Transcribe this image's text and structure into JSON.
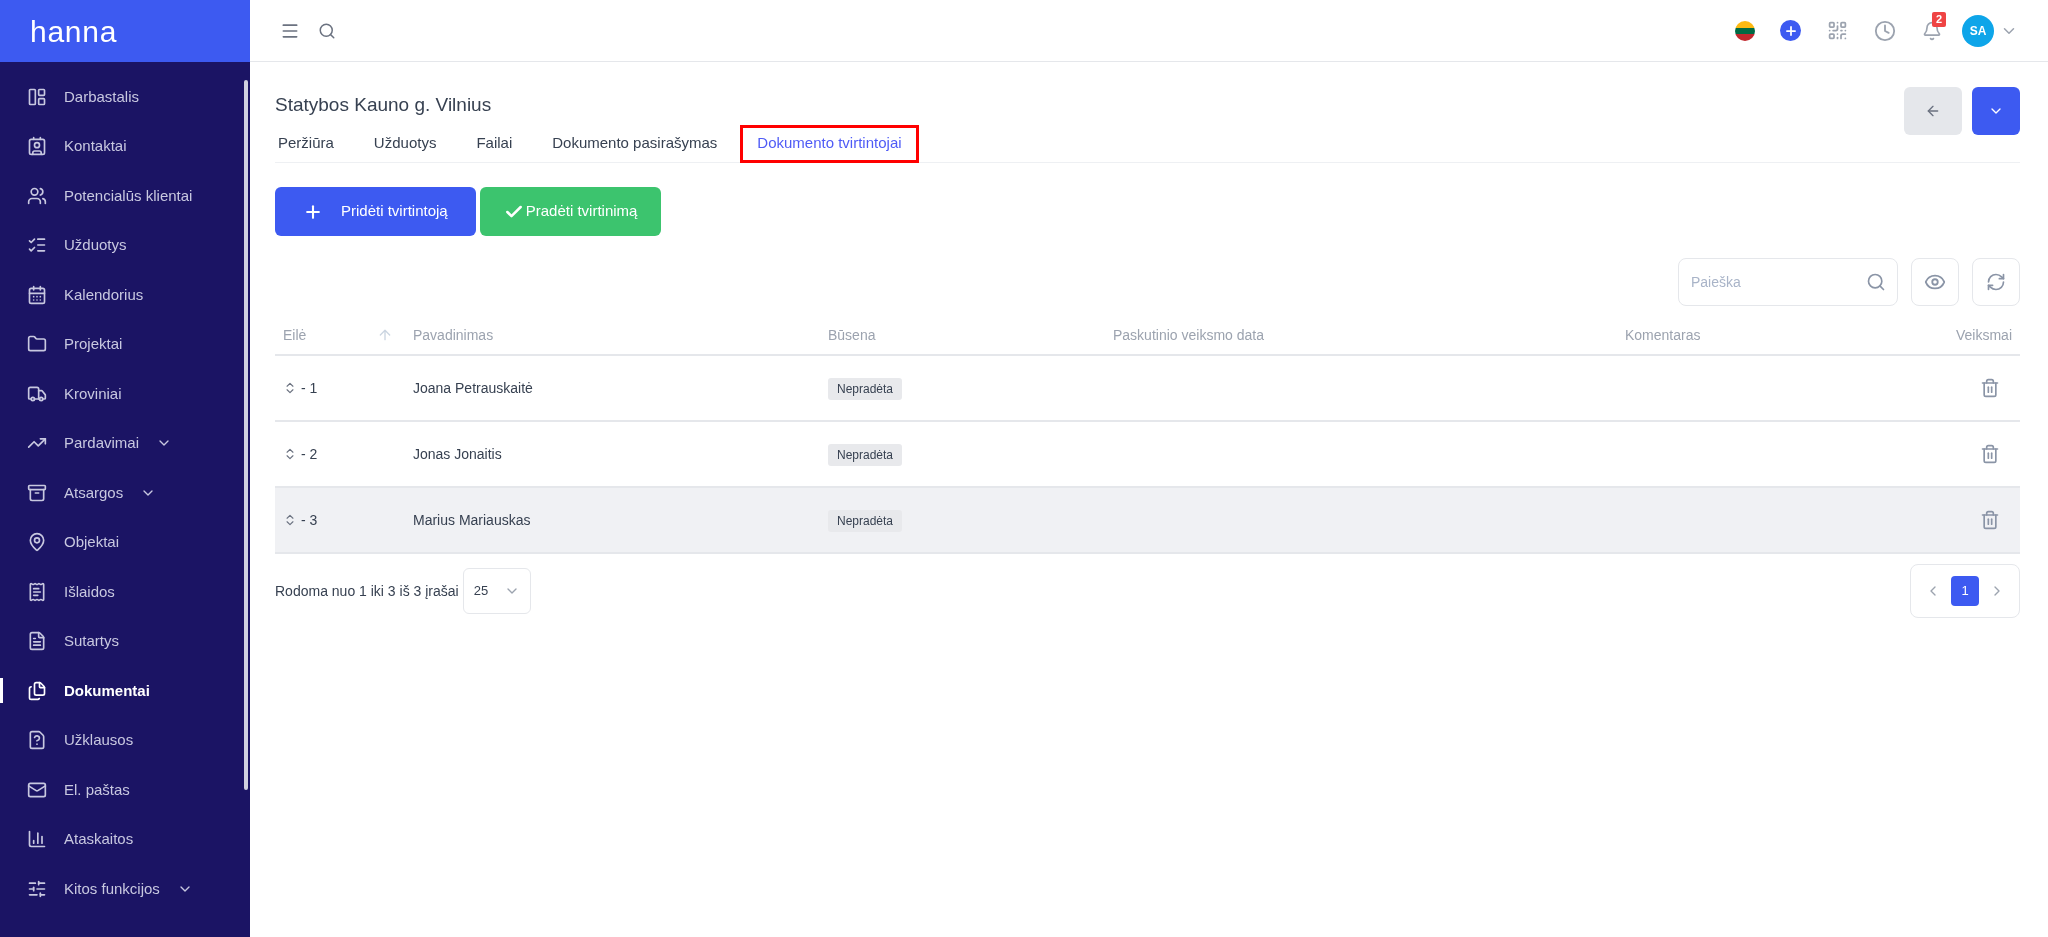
{
  "brand": "hanna",
  "sidebar": {
    "items": [
      {
        "label": "Darbastalis",
        "selected": false,
        "expandable": false
      },
      {
        "label": "Kontaktai",
        "selected": false,
        "expandable": false
      },
      {
        "label": "Potencialūs klientai",
        "selected": false,
        "expandable": false
      },
      {
        "label": "Užduotys",
        "selected": false,
        "expandable": false
      },
      {
        "label": "Kalendorius",
        "selected": false,
        "expandable": false
      },
      {
        "label": "Projektai",
        "selected": false,
        "expandable": false
      },
      {
        "label": "Kroviniai",
        "selected": false,
        "expandable": false
      },
      {
        "label": "Pardavimai",
        "selected": false,
        "expandable": true
      },
      {
        "label": "Atsargos",
        "selected": false,
        "expandable": true
      },
      {
        "label": "Objektai",
        "selected": false,
        "expandable": false
      },
      {
        "label": "Išlaidos",
        "selected": false,
        "expandable": false
      },
      {
        "label": "Sutartys",
        "selected": false,
        "expandable": false
      },
      {
        "label": "Dokumentai",
        "selected": true,
        "expandable": false
      },
      {
        "label": "Užklausos",
        "selected": false,
        "expandable": false
      },
      {
        "label": "El. paštas",
        "selected": false,
        "expandable": false
      },
      {
        "label": "Ataskaitos",
        "selected": false,
        "expandable": false
      },
      {
        "label": "Kitos funkcijos",
        "selected": false,
        "expandable": true
      }
    ]
  },
  "topbar": {
    "notifications_badge": "2",
    "avatar": "SA"
  },
  "page": {
    "title": "Statybos Kauno g. Vilnius",
    "tabs": [
      {
        "label": "Peržiūra",
        "selected": false,
        "annotated": false
      },
      {
        "label": "Užduotys",
        "selected": false,
        "annotated": false
      },
      {
        "label": "Failai",
        "selected": false,
        "annotated": false
      },
      {
        "label": "Dokumento pasirašymas",
        "selected": false,
        "annotated": false
      },
      {
        "label": "Dokumento tvirtintojai",
        "selected": true,
        "annotated": true
      }
    ],
    "actions": [
      {
        "label": "Pridėti tvirtintoją",
        "kind": "add"
      },
      {
        "label": "Pradėti tvirtinimą",
        "kind": "start"
      }
    ]
  },
  "search": {
    "placeholder": "Paieška"
  },
  "table": {
    "columns": [
      "Eilė",
      "Pavadinimas",
      "Būsena",
      "Paskutinio veiksmo data",
      "Komentaras",
      "Veiksmai"
    ],
    "rows": [
      {
        "order": "- 1",
        "name": "Joana Petrauskaitė",
        "status": "Nepradėta",
        "hovered": false
      },
      {
        "order": "- 2",
        "name": "Jonas Jonaitis",
        "status": "Nepradėta",
        "hovered": false
      },
      {
        "order": "- 3",
        "name": "Marius Mariauskas",
        "status": "Nepradėta",
        "hovered": true
      }
    ]
  },
  "footer": {
    "summary": "Rodoma nuo 1 iki 3 iš 3 įrašai",
    "page_size": "25",
    "pages": [
      {
        "label": "1",
        "selected": true
      }
    ]
  }
}
